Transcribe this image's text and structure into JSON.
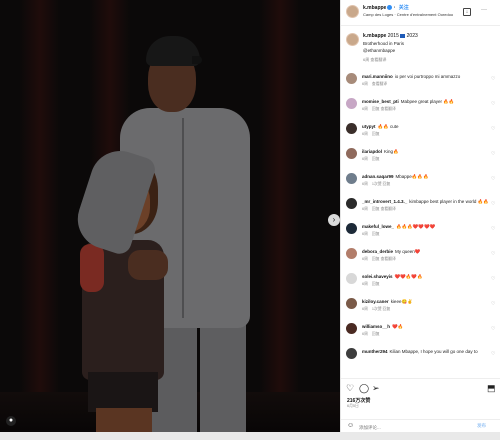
{
  "header": {
    "username": "k.mbappe",
    "follow_label": "关注",
    "location": "Camp des Loges · Centre d'entraînement Ooredoo",
    "save_icon": "save-icon",
    "more_icon": "more-icon"
  },
  "caption": {
    "username": "k.mbappe",
    "years": "2015",
    "years_to": "2023",
    "line1": "Brotherhood in Paris",
    "line2": "@ethanmbappe",
    "time": "6周",
    "translate": "查看翻译"
  },
  "comments": [
    {
      "user": "mari.manniino",
      "text": "io per voi purtroppo mi ammazzo",
      "time": "6周",
      "action": "查看翻译",
      "avatar": "#a78b7a"
    },
    {
      "user": "momise_best_pti",
      "text": "Mabpee great player 🔥🔥",
      "time": "6周",
      "action": "回复 查看翻译",
      "avatar": "#c7a7c5"
    },
    {
      "user": "utypyt",
      "text": "🔥🔥 cute",
      "time": "6周",
      "action": "回复",
      "avatar": "#3a2e2a"
    },
    {
      "user": "ilariapdol",
      "text": "King🔥",
      "time": "6周",
      "action": "回复",
      "avatar": "#8f6a5c"
    },
    {
      "user": "adnan.saqar99",
      "text": "Mbappe🔥🔥🔥",
      "time": "6周",
      "action": "1次赞 回复",
      "avatar": "#6f7d8c"
    },
    {
      "user": "_mr_introvert_1.4.3._",
      "text": "kimbappe best player in the world 🔥🔥",
      "time": "6周",
      "action": "回复 查看翻译",
      "avatar": "#2a2a2a"
    },
    {
      "user": "makeful_lowe_",
      "text": "🔥🔥🔥❤️❤️❤️❤️",
      "time": "6周",
      "action": "回复",
      "avatar": "#1d2a38"
    },
    {
      "user": "debora_derbie",
      "text": "My queen❤️",
      "time": "6周",
      "action": "回复 查看翻译",
      "avatar": "#b27d6a"
    },
    {
      "user": "solei.shaveyis",
      "text": "❤️❤️🔥❤️🔥",
      "time": "6周",
      "action": "回复",
      "avatar": "#d8d8d8"
    },
    {
      "user": "kiziloy.caner",
      "text": "kieee😋✌️",
      "time": "6周",
      "action": "1次赞 回复",
      "avatar": "#7a5a48"
    },
    {
      "user": "williamso__h",
      "text": "❤️🔥",
      "time": "6周",
      "action": "回复",
      "avatar": "#4a2a22"
    },
    {
      "user": "munther294",
      "text": "Kilian Mbappe, I hope you will go one day to",
      "time": "",
      "action": "",
      "avatar": "#3d3d3d"
    }
  ],
  "actions": {
    "like_icon": "heart-icon",
    "comment_icon": "comment-icon",
    "share_icon": "share-icon",
    "save_icon": "bookmark-icon"
  },
  "likes": "216万次赞",
  "date": "6月5日",
  "comment_box": {
    "placeholder": "添加评论...",
    "post_label": "发布"
  },
  "colors": {
    "accent": "#2f8ef5",
    "photo_bg": "#0b0909"
  }
}
